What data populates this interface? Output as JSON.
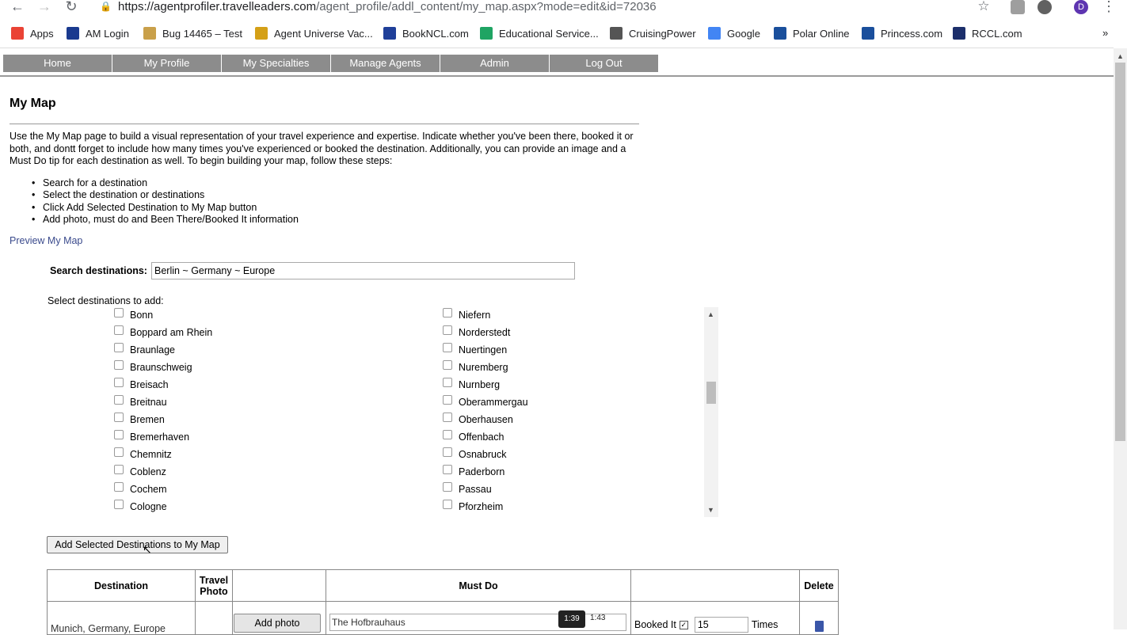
{
  "browser": {
    "url_host": "https://agentprofiler.travelleaders.com",
    "url_path": "/agent_profile/addl_content/my_map.aspx?mode=edit&id=72036",
    "profile_initial": "D",
    "bookmarks": [
      {
        "label": "Apps",
        "icon": "apps-grid-icon",
        "color": "#ea4335"
      },
      {
        "label": "AM Login",
        "icon": "am-logo-icon",
        "color": "#1a3a8f"
      },
      {
        "label": "Bug 14465 – Test",
        "icon": "bug-icon",
        "color": "#c9a04a"
      },
      {
        "label": "Agent Universe Vac...",
        "icon": "star-spark-icon",
        "color": "#d4a017"
      },
      {
        "label": "BookNCL.com",
        "icon": "ncl-icon",
        "color": "#1f3f99"
      },
      {
        "label": "Educational Service...",
        "icon": "drive-icon",
        "color": "#1fa463"
      },
      {
        "label": "CruisingPower",
        "icon": "globe-icon",
        "color": "#555555"
      },
      {
        "label": "Google",
        "icon": "google-icon",
        "color": "#4285f4"
      },
      {
        "label": "Polar Online",
        "icon": "princess-icon",
        "color": "#1a4f9c"
      },
      {
        "label": "Princess.com",
        "icon": "princess-icon",
        "color": "#1a4f9c"
      },
      {
        "label": "RCCL.com",
        "icon": "rccl-crown-icon",
        "color": "#1c2f6b"
      }
    ],
    "more_bookmarks": "»"
  },
  "nav": [
    "Home",
    "My Profile",
    "My Specialties",
    "Manage Agents",
    "Admin",
    "Log Out"
  ],
  "page": {
    "title": "My Map",
    "intro": "Use the My Map page to build a visual representation of your travel experience and expertise. Indicate whether you've been there, booked it or both, and dontt forget to include how many times you've experienced or booked the destination. Additionally, you can provide an image and a Must Do tip for each destination as well. To begin building your map, follow these steps:",
    "steps": [
      "Search for a destination",
      "Select the destination or destinations",
      "Click Add Selected Destination to My Map button",
      "Add photo, must do and Been There/Booked It information"
    ],
    "preview_link": "Preview My Map"
  },
  "search": {
    "label": "Search destinations:",
    "value": "Berlin ~ Germany ~ Europe"
  },
  "select": {
    "label": "Select destinations to add:",
    "left": [
      "Bonn",
      "Boppard am Rhein",
      "Braunlage",
      "Braunschweig",
      "Breisach",
      "Breitnau",
      "Bremen",
      "Bremerhaven",
      "Chemnitz",
      "Coblenz",
      "Cochem",
      "Cologne"
    ],
    "right": [
      "Niefern",
      "Norderstedt",
      "Nuertingen",
      "Nuremberg",
      "Nurnberg",
      "Oberammergau",
      "Oberhausen",
      "Offenbach",
      "Osnabruck",
      "Paderborn",
      "Passau",
      "Pforzheim"
    ]
  },
  "add_button": "Add Selected Destinations to My Map",
  "table": {
    "headers": [
      "Destination",
      "Travel Photo",
      "",
      "Must Do",
      "",
      "Delete"
    ],
    "row": {
      "destination": "Munich, Germany, Europe",
      "add_photo": "Add photo",
      "must_do": "The Hofbrauhaus",
      "booked_label": "Booked It",
      "booked_checked": true,
      "times_value": "15",
      "times_label": "Times"
    }
  },
  "video": {
    "current": "1:39",
    "next": "1:43"
  }
}
